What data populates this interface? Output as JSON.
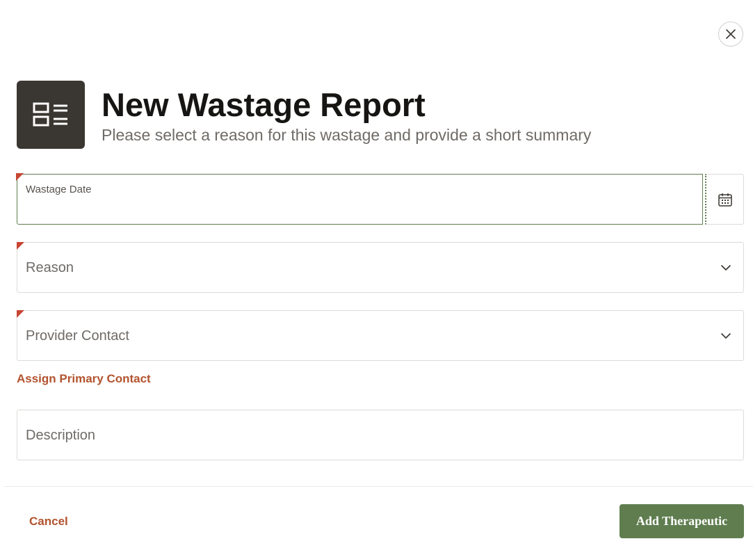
{
  "dialog": {
    "close_icon": "close-icon",
    "header_icon": "form-layout-icon",
    "title": "New Wastage Report",
    "subtitle": "Please select a reason for this wastage and provide a short summary"
  },
  "form": {
    "wastage_date": {
      "label": "Wastage Date",
      "value": "",
      "required": true,
      "icon": "calendar-icon"
    },
    "reason": {
      "placeholder": "Reason",
      "value": "",
      "required": true,
      "icon": "chevron-down-icon"
    },
    "provider_contact": {
      "placeholder": "Provider Contact",
      "value": "",
      "required": true,
      "icon": "chevron-down-icon"
    },
    "assign_primary_contact_link": "Assign Primary Contact",
    "description": {
      "placeholder": "Description",
      "value": ""
    }
  },
  "footer": {
    "cancel_label": "Cancel",
    "submit_label": "Add Therapeutic"
  },
  "colors": {
    "accent_green": "#5f7d4f",
    "link_orange": "#b2532e",
    "required_red": "#c74634",
    "header_icon_bg": "#3a3631"
  }
}
